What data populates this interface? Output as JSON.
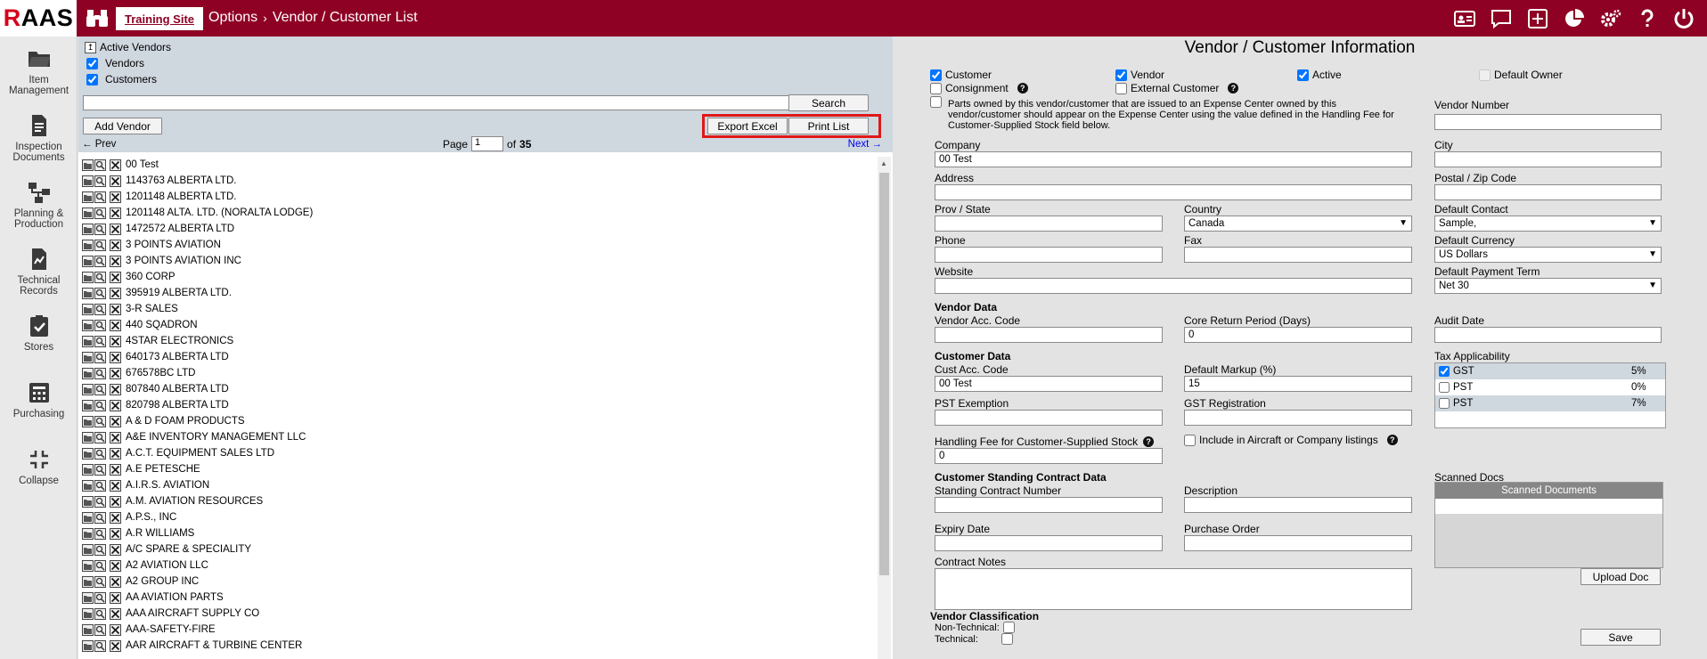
{
  "header": {
    "logo": "RAAS",
    "site_tab": "Training Site",
    "breadcrumb_root": "Options",
    "breadcrumb_sep": "›",
    "breadcrumb_page": "Vendor / Customer List",
    "icons": [
      "id-card-icon",
      "comment-icon",
      "plus-square-icon",
      "pie-chart-icon",
      "gears-icon",
      "help-icon",
      "power-icon"
    ]
  },
  "nav": [
    {
      "label": "Item Management",
      "icon": "folder-icon"
    },
    {
      "label": "Inspection Documents",
      "icon": "document-icon"
    },
    {
      "label": "Planning & Production",
      "icon": "flow-icon"
    },
    {
      "label": "Technical Records",
      "icon": "records-icon"
    },
    {
      "label": "Stores",
      "icon": "clipboard-check-icon"
    },
    {
      "label": "Purchasing",
      "icon": "calculator-icon"
    },
    {
      "label": "Collapse",
      "icon": "collapse-icon"
    }
  ],
  "filter": {
    "active_vendors": "Active Vendors",
    "vendors": "Vendors",
    "customers": "Customers",
    "search_value": "",
    "search_button": "Search",
    "add_vendor": "Add Vendor",
    "export_excel": "Export Excel",
    "print_list": "Print List",
    "prev": "← Prev",
    "next": "Next →",
    "page_label": "Page",
    "page_value": "1",
    "of_label": "of",
    "total_pages": "35"
  },
  "vendors": [
    "00 Test",
    "1143763 ALBERTA LTD.",
    "1201148 ALBERTA LTD.",
    "1201148 ALTA. LTD. (NORALTA LODGE)",
    "1472572 ALBERTA LTD",
    "3 POINTS AVIATION",
    "3 POINTS AVIATION INC",
    "360 CORP",
    "395919 ALBERTA LTD.",
    "3-R SALES",
    "440 SQADRON",
    "4STAR ELECTRONICS",
    "640173 ALBERTA LTD",
    "676578BC LTD",
    "807840 ALBERTA LTD",
    "820798 ALBERTA LTD",
    "A & D FOAM PRODUCTS",
    "A&E INVENTORY MANAGEMENT LLC",
    "A.C.T. EQUIPMENT SALES LTD",
    "A.E PETESCHE",
    "A.I.R.S. AVIATION",
    "A.M. AVIATION RESOURCES",
    "A.P.S., INC",
    "A.R WILLIAMS",
    "A/C SPARE & SPECIALITY",
    "A2 AVIATION LLC",
    "A2 GROUP INC",
    "AA AVIATION PARTS",
    "AAA AIRCRAFT SUPPLY CO",
    "AAA-SAFETY-FIRE",
    "AAR AIRCRAFT & TURBINE CENTER"
  ],
  "detail": {
    "title": "Vendor / Customer Information",
    "customer": "Customer",
    "vendor": "Vendor",
    "active": "Active",
    "default_owner": "Default Owner",
    "consignment": "Consignment",
    "external_customer": "External Customer",
    "parts_note": "Parts owned by this vendor/customer that are issued to an Expense Center owned by this vendor/customer should appear on the Expense Center using the value defined in the Handling Fee for Customer-Supplied Stock field below.",
    "vendor_number_label": "Vendor Number",
    "vendor_number": "",
    "company_label": "Company",
    "company": "00 Test",
    "city_label": "City",
    "city": "",
    "address_label": "Address",
    "address": "",
    "postal_label": "Postal / Zip Code",
    "postal": "",
    "prov_label": "Prov / State",
    "prov": "",
    "country_label": "Country",
    "country": "Canada",
    "default_contact_label": "Default Contact",
    "default_contact": "Sample,",
    "phone_label": "Phone",
    "phone": "",
    "fax_label": "Fax",
    "fax": "",
    "default_currency_label": "Default Currency",
    "default_currency": "US Dollars",
    "website_label": "Website",
    "website": "",
    "default_payment_label": "Default Payment Term",
    "default_payment": "Net 30",
    "vendor_data": "Vendor Data",
    "vendor_acc_label": "Vendor Acc. Code",
    "vendor_acc": "",
    "core_return_label": "Core Return Period (Days)",
    "core_return": "0",
    "audit_date_label": "Audit Date",
    "audit_date": "",
    "customer_data": "Customer Data",
    "cust_acc_label": "Cust Acc. Code",
    "cust_acc": "00 Test",
    "default_markup_label": "Default Markup (%)",
    "default_markup": "15",
    "tax_label": "Tax Applicability",
    "taxes": [
      {
        "name": "GST",
        "rate": "5%",
        "checked": true
      },
      {
        "name": "PST",
        "rate": "0%",
        "checked": false
      },
      {
        "name": "PST",
        "rate": "7%",
        "checked": false
      }
    ],
    "pst_exemption_label": "PST Exemption",
    "pst_exemption": "",
    "gst_registration_label": "GST Registration",
    "gst_registration": "",
    "handling_fee_label": "Handling Fee for Customer-Supplied Stock",
    "handling_fee": "0",
    "include_aircraft": "Include in Aircraft or Company listings",
    "standing_contract": "Customer Standing Contract Data",
    "scanned_docs_label": "Scanned Docs",
    "scanned_docs_header": "Scanned Documents",
    "standing_number_label": "Standing Contract Number",
    "standing_number": "",
    "description_label": "Description",
    "description": "",
    "expiry_label": "Expiry Date",
    "expiry": "",
    "purchase_order_label": "Purchase Order",
    "purchase_order": "",
    "upload_doc": "Upload Doc",
    "contract_notes_label": "Contract Notes",
    "vendor_classification": "Vendor Classification",
    "non_technical": "Non-Technical:",
    "technical": "Technical:",
    "save": "Save"
  },
  "colors": {
    "brand": "#8e0024",
    "filter_bg": "#cfd7df",
    "highlight": "#e01818"
  }
}
